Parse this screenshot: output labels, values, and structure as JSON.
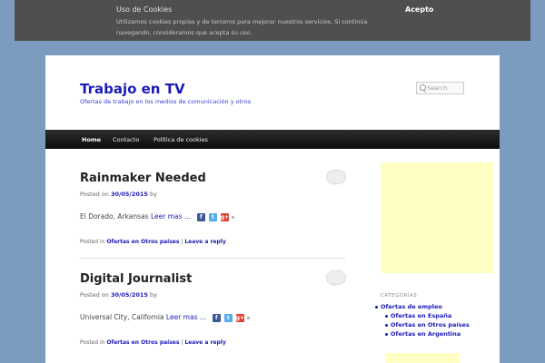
{
  "cookie": {
    "title": "Uso de Cookies",
    "text": "Utilizamos cookies propias y de terceros para mejorar nuestros servicios. Si continúa navegando, consideramos que acepta su uso.",
    "accept_label": "Acepto"
  },
  "header": {
    "site_title": "Trabajo en TV",
    "site_description": "Ofertas de trabajo en los medios de comunicación y otros",
    "search_placeholder": "Search"
  },
  "nav": {
    "items": [
      {
        "label": "Home",
        "active": true
      },
      {
        "label": "Contacto",
        "active": false
      },
      {
        "label": "Política de cookies",
        "active": false
      }
    ]
  },
  "posts": [
    {
      "title": "Rainmaker Needed",
      "posted_on": "Posted on",
      "date": "30/05/2015",
      "by": "by",
      "excerpt": "El Dorado, Arkansas",
      "read_more": "Leer mas …",
      "posted_in": "Posted in",
      "category": "Ofertas en Otros países",
      "separator": "|",
      "reply": "Leave a reply"
    },
    {
      "title": "Digital Journalist",
      "posted_on": "Posted on",
      "date": "30/05/2015",
      "by": "by",
      "excerpt": "Universal City, California",
      "read_more": "Leer mas …",
      "posted_in": "Posted in",
      "category": "Ofertas en Otros países",
      "separator": "|",
      "reply": "Leave a reply"
    }
  ],
  "share_icons": {
    "facebook": "f",
    "twitter": "t",
    "google": "g+"
  },
  "sidebar": {
    "heading": "CATEGORÍAS",
    "categories": [
      "Ofertas de empleo",
      "Ofertas en España",
      "Ofertas en Otros países",
      "Ofertas en Argentina"
    ]
  },
  "colors": {
    "background": "#7b9bbf",
    "link": "#1b1bb8",
    "ad": "#ffffc4",
    "navbar": "#1a1a1a"
  }
}
